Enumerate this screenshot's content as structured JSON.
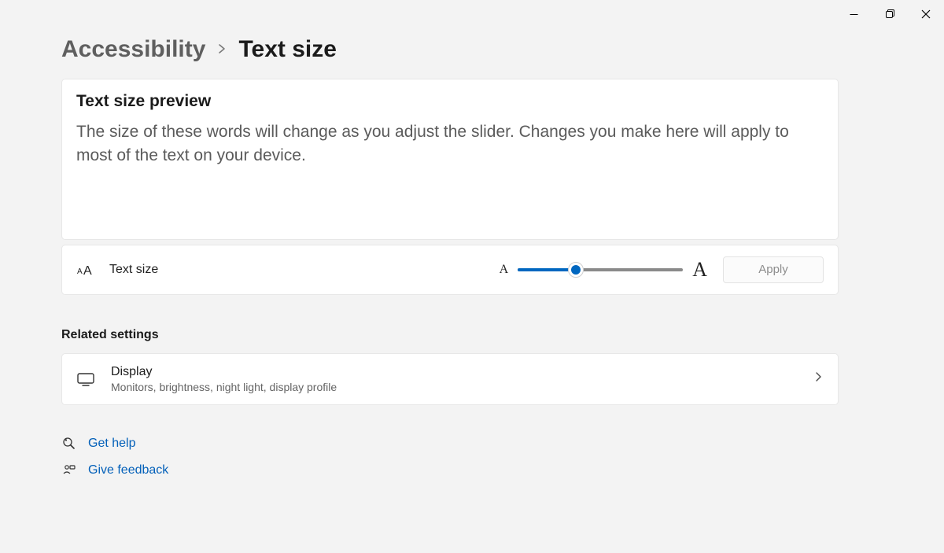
{
  "breadcrumb": {
    "parent": "Accessibility",
    "current": "Text size"
  },
  "preview": {
    "title": "Text size preview",
    "body": "The size of these words will change as you adjust the slider. Changes you make here will apply to most of the text on your device."
  },
  "text_size_row": {
    "label": "Text size",
    "small_a": "A",
    "big_a": "A",
    "apply_label": "Apply",
    "slider_percent": 35
  },
  "related": {
    "heading": "Related settings",
    "items": [
      {
        "title": "Display",
        "subtitle": "Monitors, brightness, night light, display profile"
      }
    ]
  },
  "footer": {
    "help": "Get help",
    "feedback": "Give feedback"
  }
}
